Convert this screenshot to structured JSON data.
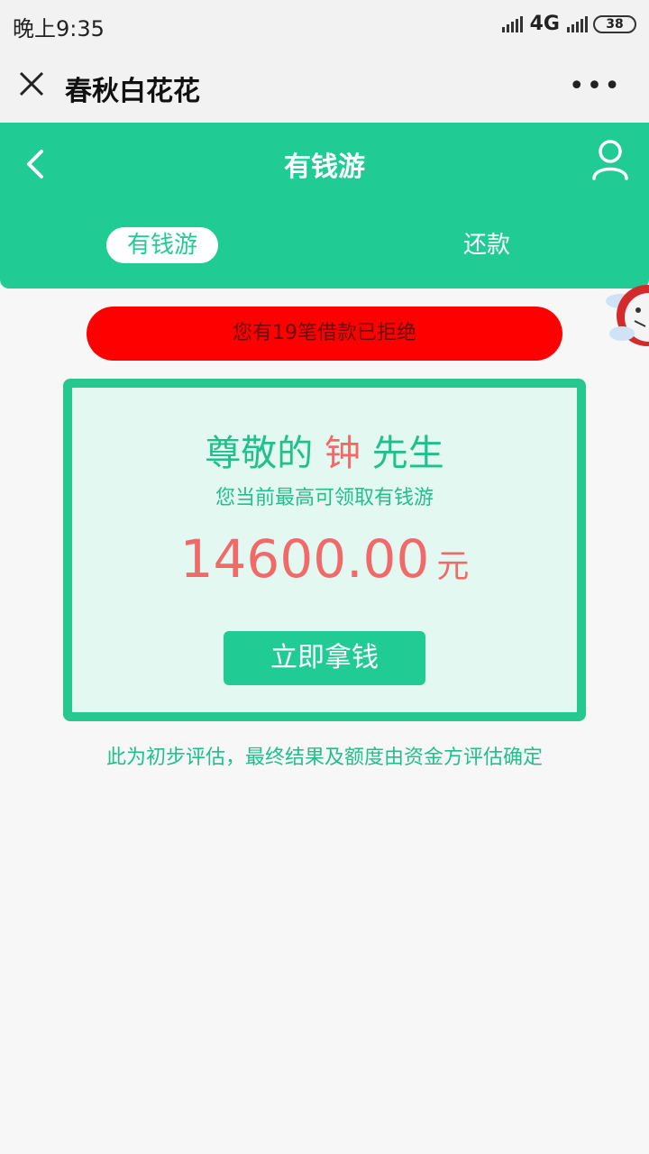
{
  "status_bar": {
    "time": "晚上9:35",
    "network": "4G",
    "battery": "38"
  },
  "wechat_bar": {
    "title": "春秋白花花",
    "more": "•••"
  },
  "header": {
    "title": "有钱游",
    "tabs": [
      {
        "label": "有钱游",
        "active": true
      },
      {
        "label": "还款",
        "active": false
      }
    ]
  },
  "notice": {
    "text": "您有19笔借款已拒绝"
  },
  "card": {
    "greeting_prefix": "尊敬的",
    "surname": "钟",
    "greeting_suffix": "先生",
    "subtitle": "您当前最高可领取有钱游",
    "amount": "14600.00",
    "currency": "元",
    "button": "立即拿钱"
  },
  "disclaimer": "此为初步评估，最终结果及额度由资金方评估确定",
  "colors": {
    "brand_green": "#20cc93",
    "accent_red": "#f06a6a",
    "banner_red": "#ff0000"
  }
}
